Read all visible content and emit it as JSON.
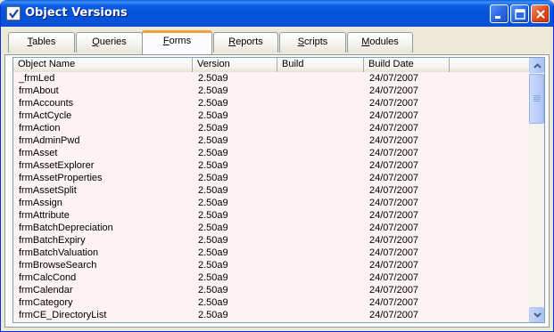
{
  "window": {
    "title": "Object Versions"
  },
  "tabs": [
    {
      "label": "Tables",
      "u": "T",
      "rest": "ables"
    },
    {
      "label": "Queries",
      "u": "Q",
      "rest": "ueries"
    },
    {
      "label": "Forms",
      "u": "F",
      "rest": "orms"
    },
    {
      "label": "Reports",
      "u": "R",
      "rest": "eports"
    },
    {
      "label": "Scripts",
      "u": "S",
      "rest": "cripts"
    },
    {
      "label": "Modules",
      "u": "M",
      "rest": "odules"
    }
  ],
  "active_tab": "Forms",
  "list": {
    "columns": [
      "Object Name",
      "Version",
      "Build",
      "Build Date"
    ],
    "rows": [
      [
        "_frmLed",
        "2.50a9",
        "",
        "24/07/2007"
      ],
      [
        "frmAbout",
        "2.50a9",
        "",
        "24/07/2007"
      ],
      [
        "frmAccounts",
        "2.50a9",
        "",
        "24/07/2007"
      ],
      [
        "frmActCycle",
        "2.50a9",
        "",
        "24/07/2007"
      ],
      [
        "frmAction",
        "2.50a9",
        "",
        "24/07/2007"
      ],
      [
        "frmAdminPwd",
        "2.50a9",
        "",
        "24/07/2007"
      ],
      [
        "frmAsset",
        "2.50a9",
        "",
        "24/07/2007"
      ],
      [
        "frmAssetExplorer",
        "2.50a9",
        "",
        "24/07/2007"
      ],
      [
        "frmAssetProperties",
        "2.50a9",
        "",
        "24/07/2007"
      ],
      [
        "frmAssetSplit",
        "2.50a9",
        "",
        "24/07/2007"
      ],
      [
        "frmAssign",
        "2.50a9",
        "",
        "24/07/2007"
      ],
      [
        "frmAttribute",
        "2.50a9",
        "",
        "24/07/2007"
      ],
      [
        "frmBatchDepreciation",
        "2.50a9",
        "",
        "24/07/2007"
      ],
      [
        "frmBatchExpiry",
        "2.50a9",
        "",
        "24/07/2007"
      ],
      [
        "frmBatchValuation",
        "2.50a9",
        "",
        "24/07/2007"
      ],
      [
        "frmBrowseSearch",
        "2.50a9",
        "",
        "24/07/2007"
      ],
      [
        "frmCalcCond",
        "2.50a9",
        "",
        "24/07/2007"
      ],
      [
        "frmCalendar",
        "2.50a9",
        "",
        "24/07/2007"
      ],
      [
        "frmCategory",
        "2.50a9",
        "",
        "24/07/2007"
      ],
      [
        "frmCE_DirectoryList",
        "2.50a9",
        "",
        "24/07/2007"
      ]
    ]
  },
  "icons": {
    "title": "checkbox-app-icon",
    "minimize": "minimize-icon",
    "maximize": "maximize-icon",
    "close": "close-icon",
    "scroll_up": "chevron-up-icon",
    "scroll_down": "chevron-down-icon"
  }
}
